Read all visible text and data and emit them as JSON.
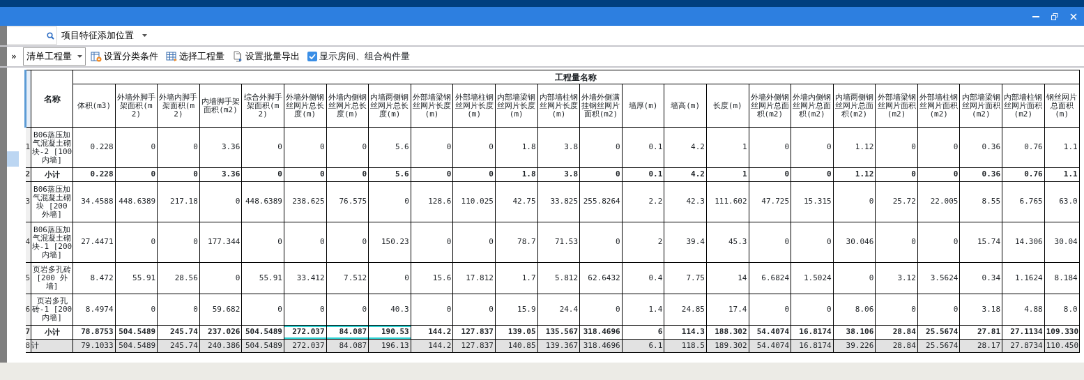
{
  "position_dropdown": {
    "label": "项目特征添加位置"
  },
  "toolbar": {
    "expand": "»",
    "quantity_dropdown": "清单工程量",
    "buttons": [
      {
        "kind": "classify",
        "label": "设置分类条件"
      },
      {
        "kind": "select",
        "label": "选择工程量"
      },
      {
        "kind": "export",
        "label": "设置批量导出"
      }
    ],
    "checkbox": {
      "label": "显示房间、组合构件量",
      "checked": true
    }
  },
  "side_panel": {
    "highlight": true
  },
  "table": {
    "name_header": "名称",
    "group_header": "工程量名称",
    "columns": [
      "体积(m3)",
      "外墙外脚手架面积(m2)",
      "外墙内脚手架面积(m2)",
      "内墙脚手架面积(m2)",
      "综合外脚手架面积(m2)",
      "外墙外侧钢丝网片总长度(m)",
      "外墙内侧钢丝网片总长度(m)",
      "内墙两侧钢丝网片总长度(m)",
      "外部墙梁钢丝网片长度(m)",
      "外部墙柱钢丝网片长度(m)",
      "内部墙梁钢丝网片长度(m)",
      "内部墙柱钢丝网片长度(m)",
      "外墙外侧满挂钢丝网片面积(m2)",
      "墙厚(m)",
      "墙高(m)",
      "长度(m)",
      "外墙外侧钢丝网片总面积(m2)",
      "外墙内侧钢丝网片总面积(m2)",
      "内墙两侧钢丝网片总面积(m2)",
      "外部墙梁钢丝网片面积(m2)",
      "外部墙柱钢丝网片面积(m2)",
      "内部墙梁钢丝网片面积(m2)",
      "内部墙柱钢丝网片面积(m2)",
      "钢丝网片总面积(m)"
    ],
    "rows": [
      {
        "num": "1",
        "kind": "item",
        "name": "B06蒸压加气混凝土砌块-2 [100 内墙]",
        "cells": [
          "0.228",
          "0",
          "0",
          "3.36",
          "0",
          "0",
          "0",
          "5.6",
          "0",
          "0",
          "1.8",
          "3.8",
          "0",
          "0.1",
          "4.2",
          "1",
          "0",
          "0",
          "1.12",
          "0",
          "0",
          "0.36",
          "0.76",
          "1.1"
        ],
        "selected": [
          false,
          false,
          false,
          false,
          false,
          false,
          false,
          false,
          false,
          false,
          false,
          false,
          false,
          false,
          false,
          false,
          false,
          false,
          false,
          false,
          false,
          false,
          false,
          false
        ]
      },
      {
        "num": "2",
        "kind": "subtotal",
        "name": "小计",
        "cells": [
          "0.228",
          "0",
          "0",
          "3.36",
          "0",
          "0",
          "0",
          "5.6",
          "0",
          "0",
          "1.8",
          "3.8",
          "0",
          "0.1",
          "4.2",
          "1",
          "0",
          "0",
          "1.12",
          "0",
          "0",
          "0.36",
          "0.76",
          "1.1"
        ],
        "selected": [
          false,
          false,
          false,
          false,
          false,
          false,
          false,
          false,
          false,
          false,
          false,
          false,
          false,
          false,
          false,
          false,
          false,
          false,
          false,
          false,
          false,
          false,
          false,
          false
        ]
      },
      {
        "num": "3",
        "kind": "item",
        "name": "B06蒸压加气混凝土砌块 [200 外墙]",
        "cells": [
          "34.4588",
          "448.6389",
          "217.18",
          "0",
          "448.6389",
          "238.625",
          "76.575",
          "0",
          "128.6",
          "110.025",
          "42.75",
          "33.825",
          "255.8264",
          "2.2",
          "42.3",
          "111.602",
          "47.725",
          "15.315",
          "0",
          "25.72",
          "22.005",
          "8.55",
          "6.765",
          "63.0"
        ],
        "selected": [
          false,
          false,
          false,
          false,
          false,
          false,
          false,
          false,
          false,
          false,
          false,
          false,
          false,
          false,
          false,
          false,
          false,
          false,
          false,
          false,
          false,
          false,
          false,
          false
        ]
      },
      {
        "num": "4",
        "kind": "item",
        "name": "B06蒸压加气混凝土砌块-1 [200 内墙]",
        "cells": [
          "27.4471",
          "0",
          "0",
          "177.344",
          "0",
          "0",
          "0",
          "150.23",
          "0",
          "0",
          "78.7",
          "71.53",
          "0",
          "2",
          "39.4",
          "45.3",
          "0",
          "0",
          "30.046",
          "0",
          "0",
          "15.74",
          "14.306",
          "30.04"
        ],
        "selected": [
          false,
          false,
          false,
          false,
          false,
          false,
          false,
          false,
          false,
          false,
          false,
          false,
          false,
          false,
          false,
          false,
          false,
          false,
          false,
          false,
          false,
          false,
          false,
          false
        ]
      },
      {
        "num": "5",
        "kind": "item",
        "name": "页岩多孔砖 [200 外墙]",
        "cells": [
          "8.472",
          "55.91",
          "28.56",
          "0",
          "55.91",
          "33.412",
          "7.512",
          "0",
          "15.6",
          "17.812",
          "1.7",
          "5.812",
          "62.6432",
          "0.4",
          "7.75",
          "14",
          "6.6824",
          "1.5024",
          "0",
          "3.12",
          "3.5624",
          "0.34",
          "1.1624",
          "8.184"
        ],
        "selected": [
          false,
          false,
          false,
          false,
          false,
          false,
          false,
          false,
          false,
          false,
          false,
          false,
          false,
          false,
          false,
          false,
          false,
          false,
          false,
          false,
          false,
          false,
          false,
          false
        ]
      },
      {
        "num": "6",
        "kind": "item",
        "name": "页岩多孔砖-1 [200 内墙]",
        "cells": [
          "8.4974",
          "0",
          "0",
          "59.682",
          "0",
          "0",
          "0",
          "40.3",
          "0",
          "0",
          "15.9",
          "24.4",
          "0",
          "1.4",
          "24.85",
          "17.4",
          "0",
          "0",
          "8.06",
          "0",
          "0",
          "3.18",
          "4.88",
          "8.0"
        ],
        "selected": [
          false,
          false,
          false,
          false,
          false,
          false,
          false,
          false,
          false,
          false,
          false,
          false,
          false,
          false,
          false,
          false,
          false,
          false,
          false,
          false,
          false,
          false,
          false,
          false
        ]
      },
      {
        "num": "7",
        "kind": "subtotal",
        "name": "小计",
        "cells": [
          "78.8753",
          "504.5489",
          "245.74",
          "237.026",
          "504.5489",
          "272.037",
          "84.087",
          "190.53",
          "144.2",
          "127.837",
          "139.05",
          "135.567",
          "318.4696",
          "6",
          "114.3",
          "188.302",
          "54.4074",
          "16.8174",
          "38.106",
          "28.84",
          "25.5674",
          "27.81",
          "27.1134",
          "109.330"
        ],
        "selected": [
          false,
          false,
          false,
          false,
          false,
          true,
          true,
          true,
          false,
          false,
          false,
          false,
          false,
          false,
          false,
          false,
          false,
          false,
          false,
          false,
          false,
          false,
          false,
          false
        ]
      },
      {
        "num": "8",
        "kind": "total",
        "name": "计",
        "cells": [
          "79.1033",
          "504.5489",
          "245.74",
          "240.386",
          "504.5489",
          "272.037",
          "84.087",
          "196.13",
          "144.2",
          "127.837",
          "140.85",
          "139.367",
          "318.4696",
          "6.1",
          "118.5",
          "189.302",
          "54.4074",
          "16.8174",
          "39.226",
          "28.84",
          "25.5674",
          "28.17",
          "27.8734",
          "110.450"
        ],
        "selected": [
          false,
          false,
          false,
          false,
          false,
          false,
          false,
          false,
          false,
          false,
          false,
          false,
          false,
          false,
          false,
          false,
          false,
          false,
          false,
          false,
          false,
          false,
          false,
          false
        ]
      }
    ]
  }
}
